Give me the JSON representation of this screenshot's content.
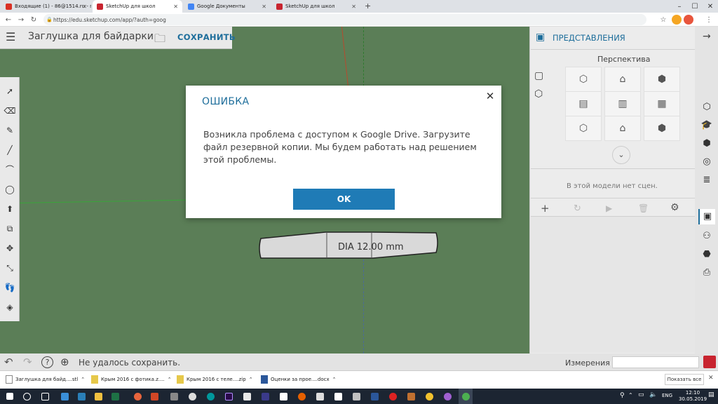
{
  "browser": {
    "tabs": [
      {
        "label": "Входящие (1) - 86@1514.ru - по",
        "color": "#d93025"
      },
      {
        "label": "SketchUp для школ",
        "color": "#c8242f",
        "active": true
      },
      {
        "label": "Google Документы",
        "color": "#4285f4"
      },
      {
        "label": "SketchUp для школ",
        "color": "#c8242f"
      }
    ],
    "new_tab": "+",
    "url": "https://edu.sketchup.com/app/?auth=goog"
  },
  "app": {
    "model_title": "Заглушка для байдарки",
    "save_label": "СОХРАНИТЬ",
    "dimension_label": "DIA 12.00 mm",
    "status_message": "Не удалось сохранить.",
    "measurements_label": "Измерения",
    "panel": {
      "title": "ПРЕДСТАВЛЕНИЯ",
      "subtitle": "Перспектива",
      "no_scenes": "В этой модели нет сцен."
    }
  },
  "dialog": {
    "title": "ОШИБКА",
    "message": "Возникла проблема с доступом к Google Drive. Загрузите файл резервной копии. Мы будем работать над решением этой проблемы.",
    "ok_label": "OK"
  },
  "downloads": {
    "items": [
      {
        "label": "Заглушка для байд....stl"
      },
      {
        "label": "Крым 2016 с фотика.z...."
      },
      {
        "label": "Крым 2016 с теле....zip"
      },
      {
        "label": "Оценки за прое....docx"
      }
    ],
    "show_all": "Показать все"
  },
  "taskbar": {
    "lang": "ENG",
    "time": "12:10",
    "date": "30.05.2019"
  },
  "colors": {
    "accent": "#1e6e9b",
    "ok_button": "#1f7bb6",
    "viewport": "#5b7e57"
  }
}
